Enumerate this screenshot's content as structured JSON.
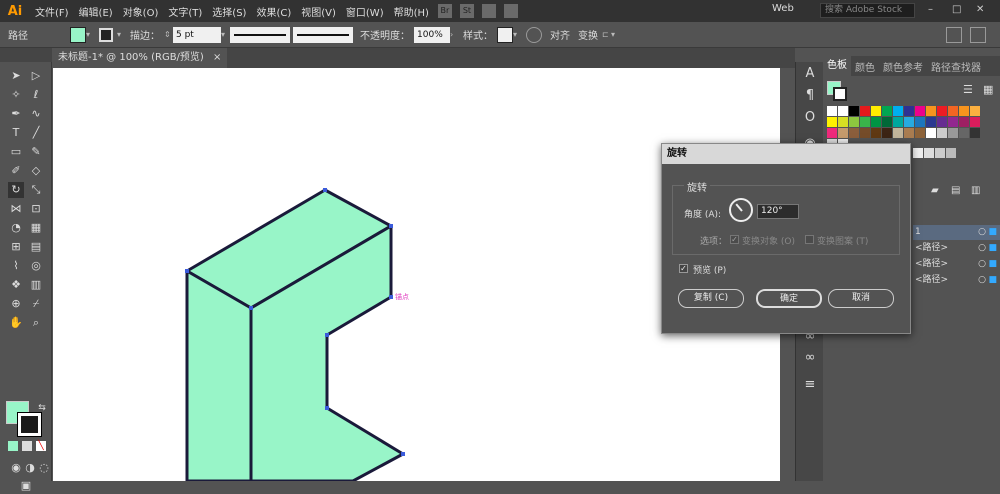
{
  "app": {
    "logo": "Ai",
    "menus": [
      "文件(F)",
      "编辑(E)",
      "对象(O)",
      "文字(T)",
      "选择(S)",
      "效果(C)",
      "视图(V)",
      "窗口(W)",
      "帮助(H)"
    ],
    "bridge": "Br",
    "stock": "St",
    "workspace": "Web",
    "search_placeholder": "搜索 Adobe Stock"
  },
  "control": {
    "object_type": "路径",
    "stroke_label": "描边：",
    "stroke_value": "5 pt",
    "profile_label": "等比",
    "brush_label": "基本",
    "opacity_label": "不透明度：",
    "opacity_value": "100%",
    "style_label": "样式：",
    "align_label": "对齐",
    "transform_label": "变换"
  },
  "document": {
    "tab_title": "未标题-1* @ 100% (RGB/预览)",
    "close": "×"
  },
  "canvas": {
    "anchor_hint": "锚点"
  },
  "panel": {
    "tabs": [
      "色板",
      "颜色",
      "颜色参考",
      "路径查找器"
    ],
    "layers": [
      {
        "label": "1",
        "selected": true
      },
      {
        "label": "<路径>",
        "selected": false
      },
      {
        "label": "<路径>",
        "selected": false
      },
      {
        "label": "<路径>",
        "selected": false
      }
    ]
  },
  "dialog": {
    "title": "旋转",
    "group_label": "旋转",
    "angle_label": "角度 (A):",
    "angle_value": "120°",
    "options_label": "选项：",
    "transform_objects": "变换对象 (O)",
    "transform_patterns": "变换图案 (T)",
    "preview_label": "预览 (P)",
    "preview_checked": true,
    "copy_button": "复制 (C)",
    "ok_button": "确定",
    "cancel_button": "取消"
  },
  "colors": {
    "fill": "#98f5c8",
    "stroke": "#1a1a1a",
    "anchor_hint": "#e040c0"
  }
}
